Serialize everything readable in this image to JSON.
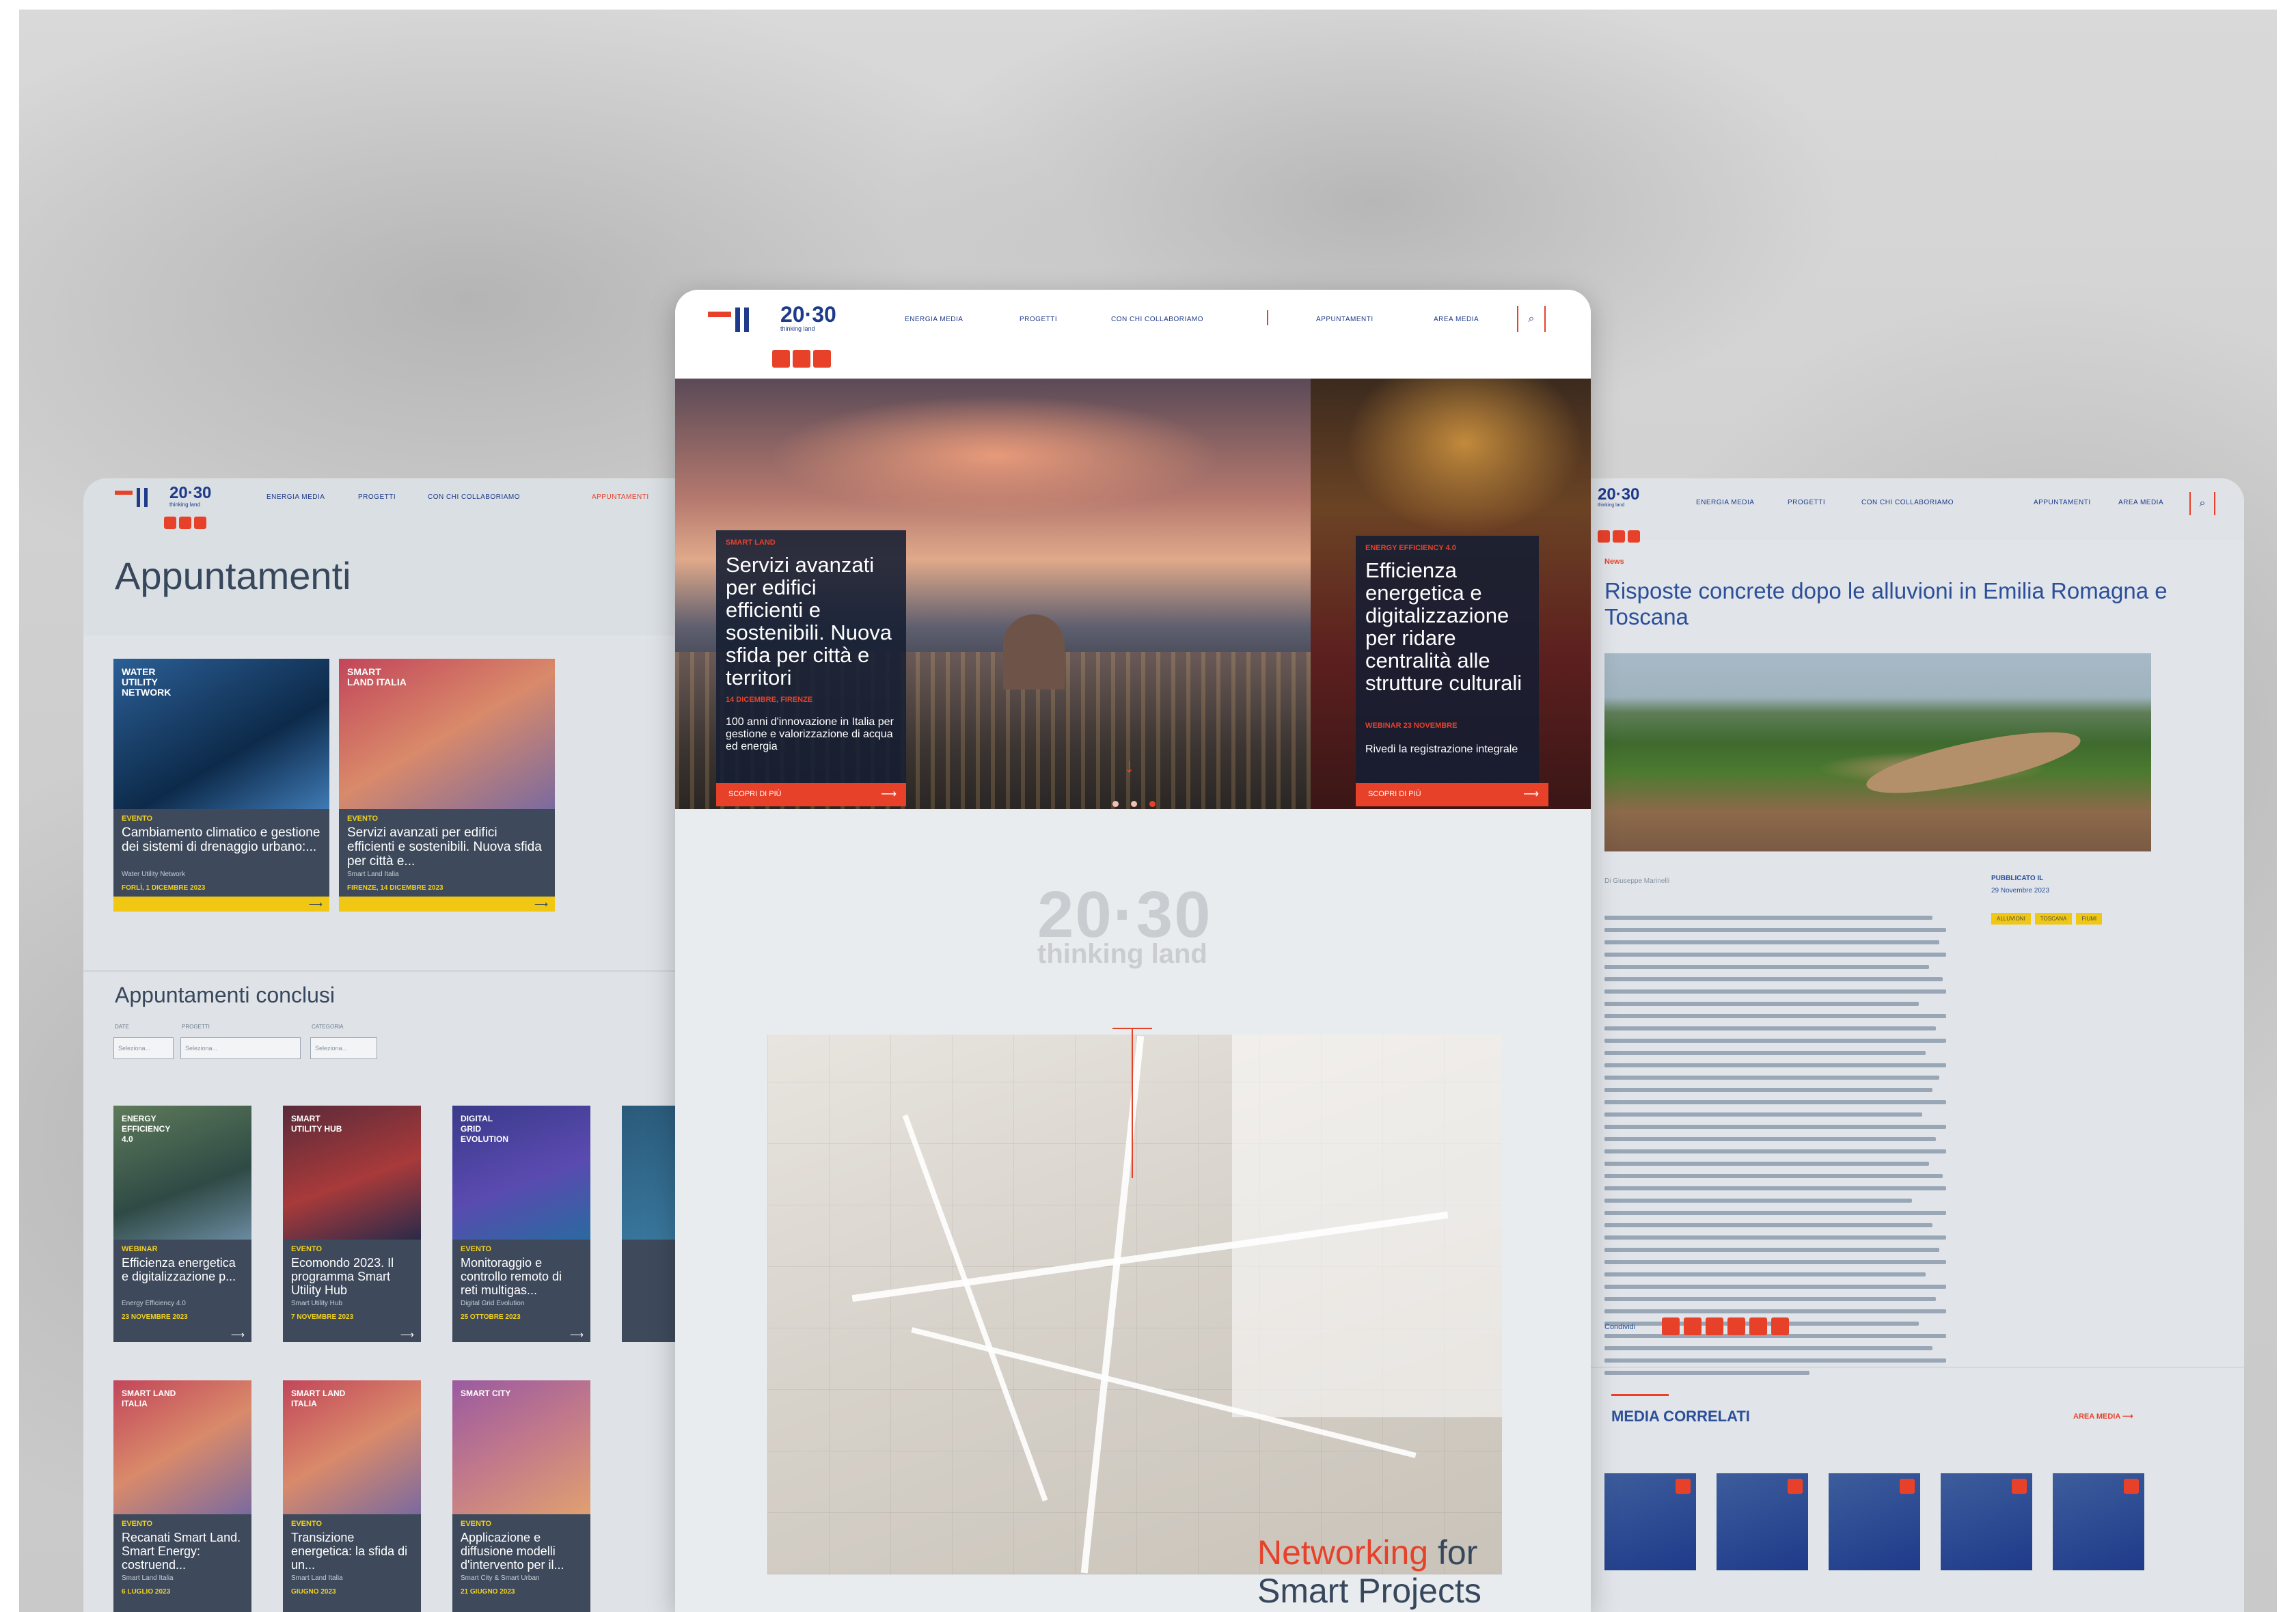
{
  "brand": {
    "logo_main": "20·30",
    "logo_sub": "thinking land"
  },
  "colors": {
    "accent": "#e8412a",
    "navy": "#1e3a8a",
    "yellow": "#f0c814"
  },
  "nav": {
    "items": [
      "ENERGIA MEDIA",
      "PROGETTI",
      "CON CHI COLLABORIAMO",
      "APPUNTAMENTI",
      "AREA MEDIA"
    ],
    "search_icon": "search-icon"
  },
  "left": {
    "page_title": "Appuntamenti",
    "upcoming": [
      {
        "img_label": "WATER UTILITY NETWORK",
        "tag": "EVENTO",
        "title": "Cambiamento climatico e gestione dei sistemi di drenaggio urbano:...",
        "sub": "Water Utility Network",
        "date": "FORLÌ, 1 DICEMBRE 2023"
      },
      {
        "img_label": "SMART LAND ITALIA",
        "tag": "EVENTO",
        "title": "Servizi avanzati per edifici efficienti e sostenibili. Nuova sfida per città e...",
        "sub": "Smart Land Italia",
        "date": "FIRENZE, 14 DICEMBRE 2023"
      }
    ],
    "concluded_title": "Appuntamenti conclusi",
    "filters": [
      {
        "label": "DATE",
        "value": "Seleziona..."
      },
      {
        "label": "PROGETTI",
        "value": "Seleziona..."
      },
      {
        "label": "CATEGORIA",
        "value": "Seleziona..."
      }
    ],
    "row1": [
      {
        "img_label": "ENERGY EFFICIENCY 4.0",
        "tag": "WEBINAR",
        "title": "Efficienza energetica e digitalizzazione p...",
        "sub": "Energy Efficiency 4.0",
        "date": "23 NOVEMBRE 2023"
      },
      {
        "img_label": "SMART UTILITY HUB",
        "tag": "EVENTO",
        "title": "Ecomondo 2023. Il programma Smart Utility Hub",
        "sub": "Smart Utility Hub",
        "date": "7 NOVEMBRE 2023"
      },
      {
        "img_label": "DIGITAL GRID EVOLUTION",
        "tag": "EVENTO",
        "title": "Monitoraggio e controllo remoto di reti multigas...",
        "sub": "Digital Grid Evolution",
        "date": "25 OTTOBRE 2023"
      }
    ],
    "row2": [
      {
        "img_label": "SMART LAND ITALIA",
        "tag": "EVENTO",
        "title": "Recanati Smart Land. Smart Energy: costruend...",
        "sub": "Smart Land Italia",
        "date": "6 LUGLIO 2023"
      },
      {
        "img_label": "SMART LAND ITALIA",
        "tag": "EVENTO",
        "title": "Transizione energetica: la sfida di un...",
        "sub": "Smart Land Italia",
        "date": "GIUGNO 2023"
      },
      {
        "img_label": "SMART CITY",
        "tag": "EVENTO",
        "title": "Applicazione e diffusione modelli d'intervento per il...",
        "sub": "Smart City & Smart Urban",
        "date": "21 GIUGNO 2023"
      }
    ]
  },
  "center": {
    "hero_left": {
      "kicker": "SMART LAND",
      "title": "Servizi avanzati per edifici efficienti e sostenibili. Nuova sfida per città e territori",
      "date": "14 DICEMBRE, FIRENZE",
      "desc": "100 anni d'innovazione in Italia per gestione e valorizzazione di acqua ed energia",
      "button": "SCOPRI DI PIÙ"
    },
    "hero_right": {
      "kicker": "ENERGY EFFICIENCY 4.0",
      "title": "Efficienza energetica e digitalizzazione per ridare centralità alle strutture culturali",
      "date": "WEBINAR 23 NOVEMBRE",
      "desc": "Rivedi la registrazione integrale",
      "button": "SCOPRI DI PIÙ"
    },
    "big_logo": "20·30",
    "big_logo_sub": "thinking land",
    "networking_word": "Networking",
    "networking_rest": "for",
    "networking_line2": "Smart Projects"
  },
  "right": {
    "news_label": "News",
    "title": "Risposte concrete dopo le alluvioni in Emilia Romagna e Toscana",
    "published_label": "PUBBLICATO IL",
    "published_date": "29 Novembre 2023",
    "tags": [
      "ALLUVIONI",
      "TOSCANA",
      "FIUMI"
    ],
    "share_label": "Condividi",
    "media_title": "MEDIA CORRELATI",
    "media_area": "AREA MEDIA"
  }
}
